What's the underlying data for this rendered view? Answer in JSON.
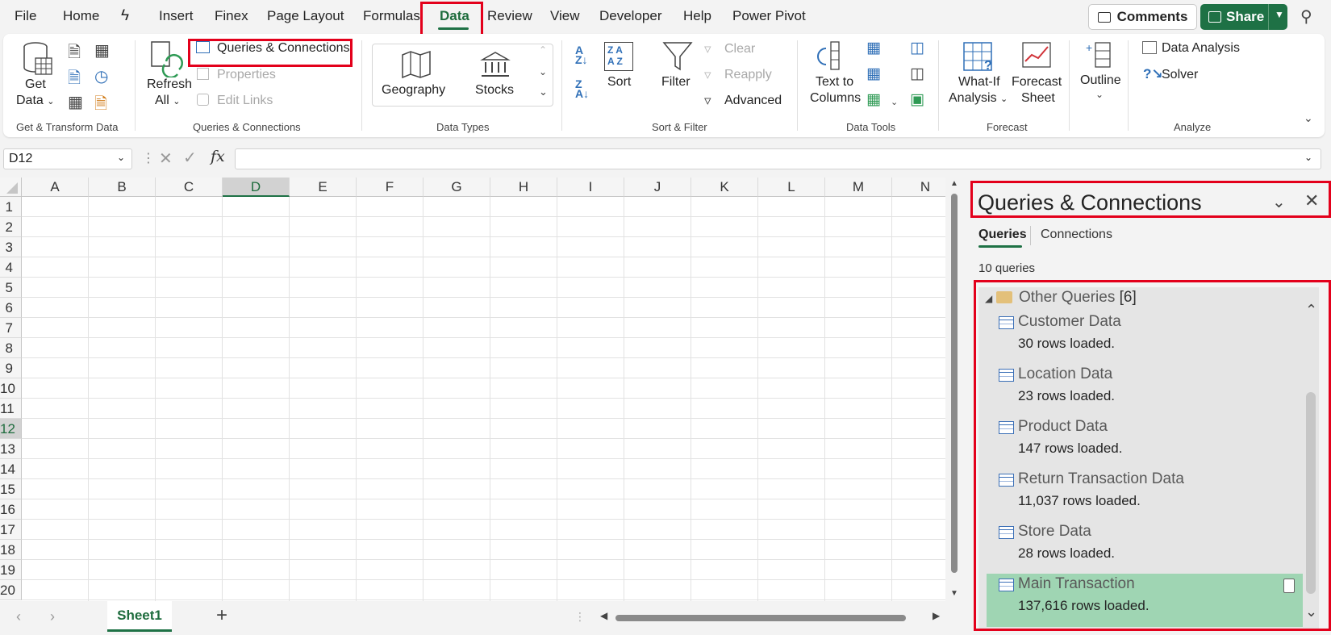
{
  "menu": {
    "file": "File",
    "home": "Home",
    "insert": "Insert",
    "finex": "Finex",
    "page_layout": "Page Layout",
    "formulas": "Formulas",
    "data": "Data",
    "review": "Review",
    "view": "View",
    "developer": "Developer",
    "help": "Help",
    "power_pivot": "Power Pivot",
    "comments": "Comments",
    "share": "Share"
  },
  "ribbon": {
    "get_data_line1": "Get",
    "get_data_line2": "Data",
    "refresh_line1": "Refresh",
    "refresh_line2": "All",
    "queries_connections": "Queries & Connections",
    "properties": "Properties",
    "edit_links": "Edit Links",
    "geography": "Geography",
    "stocks": "Stocks",
    "sort": "Sort",
    "filter": "Filter",
    "clear": "Clear",
    "reapply": "Reapply",
    "advanced": "Advanced",
    "text_to_line1": "Text to",
    "text_to_line2": "Columns",
    "whatif_line1": "What-If",
    "whatif_line2": "Analysis",
    "forecast_line1": "Forecast",
    "forecast_line2": "Sheet",
    "outline": "Outline",
    "data_analysis": "Data Analysis",
    "solver": "Solver",
    "groups": {
      "get_transform": "Get & Transform Data",
      "queries_connections": "Queries & Connections",
      "data_types": "Data Types",
      "sort_filter": "Sort & Filter",
      "data_tools": "Data Tools",
      "forecast": "Forecast",
      "analyze": "Analyze"
    }
  },
  "formula_bar": {
    "name_box": "D12",
    "fx": "fx",
    "value": ""
  },
  "grid": {
    "columns": [
      "A",
      "B",
      "C",
      "D",
      "E",
      "F",
      "G",
      "H",
      "I",
      "J",
      "K",
      "L",
      "M",
      "N"
    ],
    "selected_column": "D",
    "rows": [
      "1",
      "2",
      "3",
      "4",
      "5",
      "6",
      "7",
      "8",
      "9",
      "10",
      "11",
      "12",
      "13",
      "14",
      "15",
      "16",
      "17",
      "18",
      "19",
      "20"
    ],
    "selected_row": "12"
  },
  "sheets": {
    "active": "Sheet1"
  },
  "panel": {
    "title": "Queries & Connections",
    "tab_queries": "Queries",
    "tab_connections": "Connections",
    "count": "10 queries",
    "group_name": "Other Queries",
    "group_count": "[6]",
    "queries": [
      {
        "name": "Customer Data",
        "rows": "30 rows loaded."
      },
      {
        "name": "Location Data",
        "rows": "23 rows loaded."
      },
      {
        "name": "Product Data",
        "rows": "147 rows loaded."
      },
      {
        "name": "Return Transaction Data",
        "rows": "11,037 rows loaded."
      },
      {
        "name": "Store Data",
        "rows": "28 rows loaded."
      },
      {
        "name": "Main Transaction",
        "rows": "137,616 rows loaded."
      }
    ]
  }
}
